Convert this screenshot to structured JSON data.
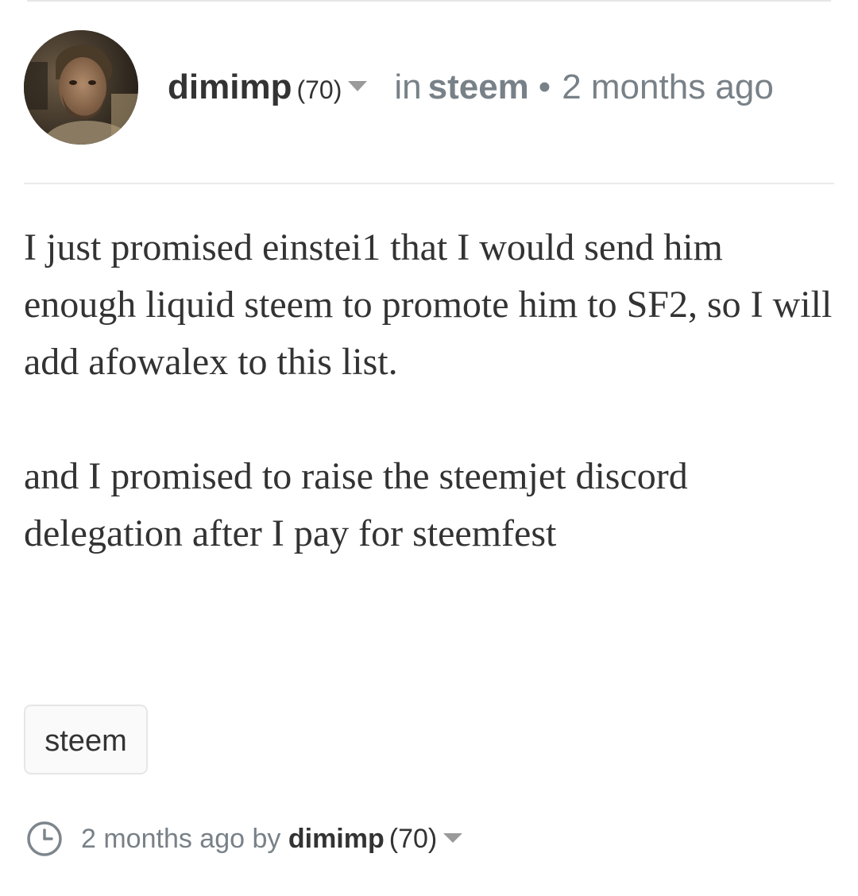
{
  "header": {
    "author": "dimimp",
    "reputation": "(70)",
    "in_label": "in",
    "category": "steem",
    "separator": "•",
    "time_ago": "2 months ago"
  },
  "body": {
    "paragraphs": [
      "I just promised einstei1 that I would send him enough liquid steem to promote him to SF2, so I will add afowalex to this list.",
      "and I promised to raise the steemjet discord delegation after I pay for steemfest"
    ]
  },
  "tags": [
    "steem"
  ],
  "footer": {
    "time_ago": "2 months ago",
    "by_label": "by",
    "author": "dimimp",
    "reputation": "(70)"
  },
  "colors": {
    "text": "#333333",
    "muted": "#788187",
    "divider": "#eaeaea",
    "tag_border": "#e6e6e6"
  },
  "icons": [
    "avatar-photo",
    "caret-down-icon",
    "clock-icon"
  ]
}
